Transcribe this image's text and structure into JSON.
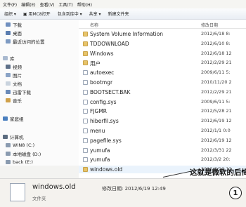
{
  "menubar": [
    "文件(F)",
    "编辑(E)",
    "查看(V)",
    "工具(T)",
    "帮助(H)"
  ],
  "toolbar": [
    "组织 ▾",
    "▣ 用MC8打开",
    "包含到库中 ▾",
    "共享 ▾",
    "新建文件夹"
  ],
  "nav": [
    {
      "label": "下载",
      "color": "#6f8fbf"
    },
    {
      "label": "桌面",
      "color": "#5a7db0"
    },
    {
      "label": "最近访问的位置",
      "color": "#7d9ac2"
    },
    {
      "label": "库",
      "color": "#a9b9cf"
    },
    {
      "label": "视频",
      "color": "#5d6f88"
    },
    {
      "label": "图片",
      "color": "#8aa3c6"
    },
    {
      "label": "文档",
      "color": "#c9d3de"
    },
    {
      "label": "迅雷下载",
      "color": "#6a8ab8"
    },
    {
      "label": "音乐",
      "color": "#d0a14a"
    },
    {
      "label": "家庭组",
      "color": "#4a7fbf"
    },
    {
      "label": "计算机",
      "color": "#5c6c80"
    },
    {
      "label": "WIN8 (C:)",
      "color": "#8a9bb0"
    },
    {
      "label": "本地磁盘 (D:)",
      "color": "#8a9bb0"
    },
    {
      "label": "back (E:)",
      "color": "#8a9bb0"
    }
  ],
  "columns": {
    "name": "名称",
    "date": "修改日期"
  },
  "files": [
    {
      "name": "System Volume Information",
      "date": "2012/6/18 8:",
      "folder": true
    },
    {
      "name": "TDDOWNLOAD",
      "date": "2012/6/10 8:",
      "folder": true
    },
    {
      "name": "Windows",
      "date": "2012/6/18 12",
      "folder": true
    },
    {
      "name": "用户",
      "date": "2012/2/29 21",
      "folder": true
    },
    {
      "name": "autoexec",
      "date": "2009/6/11 5:",
      "folder": false
    },
    {
      "name": "bootmgr",
      "date": "2010/11/20 2",
      "folder": false
    },
    {
      "name": "BOOTSECT.BAK",
      "date": "2012/2/29 21",
      "folder": false
    },
    {
      "name": "config.sys",
      "date": "2009/6/11 5:",
      "folder": false
    },
    {
      "name": "FJGMR",
      "date": "2012/5/28 21",
      "folder": false
    },
    {
      "name": "hiberfil.sys",
      "date": "2012/6/19 12",
      "folder": false
    },
    {
      "name": "menu",
      "date": "2012/1/1 0:0",
      "folder": false
    },
    {
      "name": "pagefile.sys",
      "date": "2012/6/19 12",
      "folder": false
    },
    {
      "name": "yumufa",
      "date": "2012/3/31 22",
      "folder": false
    },
    {
      "name": "yumufa",
      "date": "2012/3/2 20:",
      "folder": false
    },
    {
      "name": "windows.old",
      "date": "2012/6/19 12",
      "folder": true
    }
  ],
  "annotation": "这就是微软的后悔药",
  "details": {
    "name": "windows.old",
    "meta": "修改日期: 2012/6/19 12:49",
    "type": "文件夹"
  },
  "badge": "1"
}
